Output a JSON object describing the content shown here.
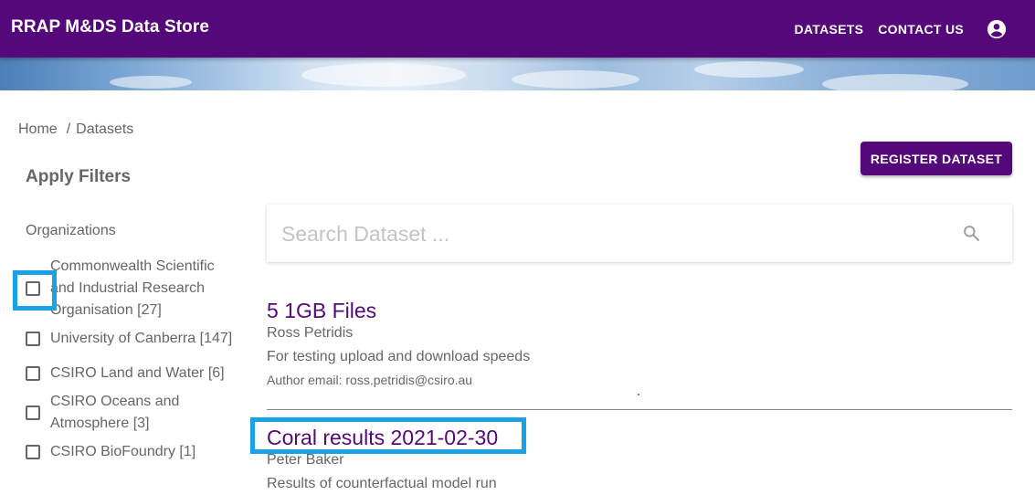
{
  "header": {
    "title": "RRAP M&DS Data Store",
    "nav": {
      "datasets": "DATASETS",
      "contact": "CONTACT US"
    },
    "account_icon": "account-circle-icon",
    "color": "#55087a"
  },
  "breadcrumb": {
    "home": "Home",
    "separator": "/",
    "current": "Datasets"
  },
  "register_button": "REGISTER DATASET",
  "filters": {
    "title": "Apply Filters",
    "section": "Organizations",
    "items": [
      {
        "label": "Commonwealth Scientific and Industrial Research Organisation [27]",
        "checked": false
      },
      {
        "label": "University of Canberra [147]",
        "checked": false
      },
      {
        "label": "CSIRO Land and Water [6]",
        "checked": false
      },
      {
        "label": "CSIRO Oceans and Atmosphere [3]",
        "checked": false
      },
      {
        "label": "CSIRO BioFoundry [1]",
        "checked": false
      }
    ]
  },
  "search": {
    "placeholder": "Search Dataset ...",
    "value": "",
    "icon": "search-icon"
  },
  "datasets": [
    {
      "title": "5 1GB Files",
      "author": "Ross Petridis",
      "description": "For testing upload and download speeds",
      "email": "Author email: ross.petridis@csiro.au"
    },
    {
      "title": "Coral results 2021-02-30",
      "author": "Peter Baker",
      "description": "Results of counterfactual model run"
    }
  ],
  "highlight_color": "#19a2e6"
}
